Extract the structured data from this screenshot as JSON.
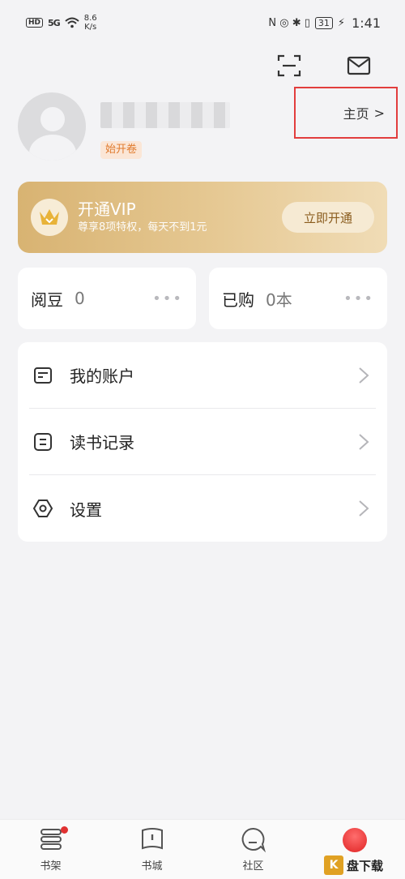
{
  "status_bar": {
    "hd": "HD",
    "signal": "5G",
    "speed_value": "8.6",
    "speed_unit": "K/s",
    "icons_right": "N ◎ ✱ ▯",
    "battery": "31",
    "time": "1:41"
  },
  "profile": {
    "username": "",
    "badge": "始开卷",
    "homepage_label": "主页",
    "homepage_chevron": ">"
  },
  "vip": {
    "title": "开通VIP",
    "subtitle": "尊享8项特权，每天不到1元",
    "button": "立即开通"
  },
  "stats": [
    {
      "label": "阅豆",
      "value": "0",
      "more": "•••"
    },
    {
      "label": "已购",
      "value": "0本",
      "more": "•••"
    }
  ],
  "menu": [
    {
      "label": "我的账户",
      "icon": "wallet-icon"
    },
    {
      "label": "读书记录",
      "icon": "record-icon"
    },
    {
      "label": "设置",
      "icon": "settings-icon"
    }
  ],
  "bottom_nav": [
    {
      "label": "书架",
      "icon": "bookshelf-icon",
      "badge": true
    },
    {
      "label": "书城",
      "icon": "bookstore-icon"
    },
    {
      "label": "社区",
      "icon": "community-icon"
    },
    {
      "label": "",
      "icon": "profile-icon"
    }
  ],
  "watermark": {
    "logo": "K",
    "text": "盘下载"
  },
  "colors": {
    "background": "#f3f3f5",
    "vip_gold": "#d8b372",
    "highlight_box": "#e23d3d",
    "badge_text": "#e07b2e",
    "nav_dot": "#e03131"
  }
}
